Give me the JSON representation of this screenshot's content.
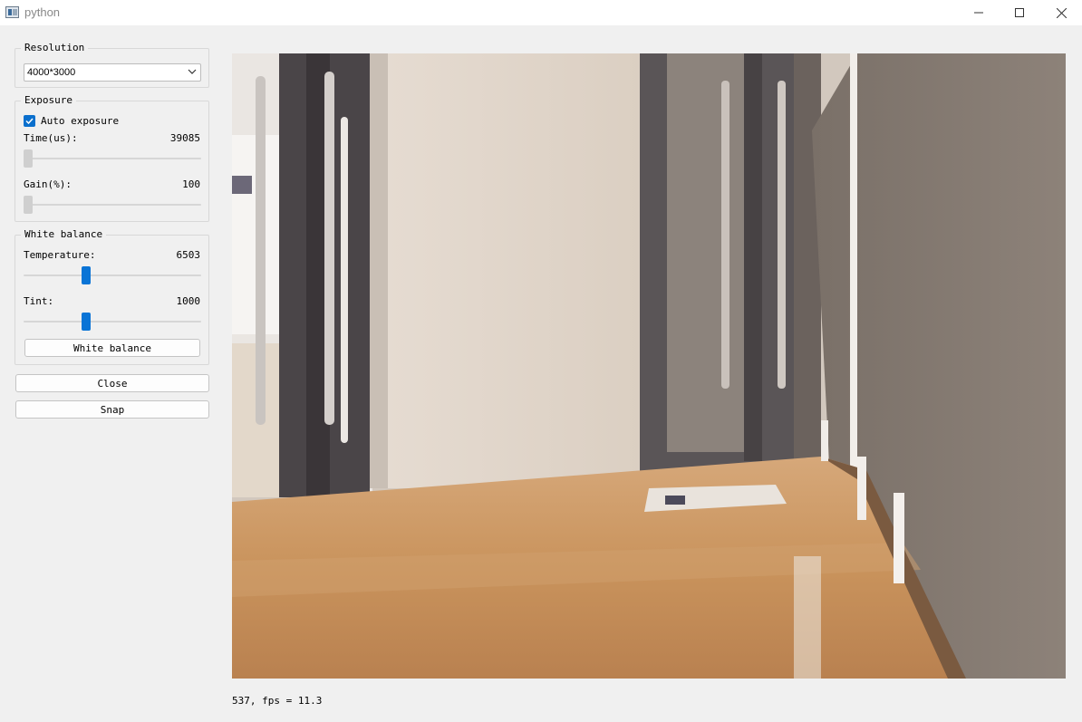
{
  "window": {
    "title": "python"
  },
  "resolution": {
    "title": "Resolution",
    "selected": "4000*3000"
  },
  "exposure": {
    "title": "Exposure",
    "auto_label": "Auto exposure",
    "auto_checked": true,
    "time_label": "Time(us):",
    "time_value": "39085",
    "gain_label": "Gain(%):",
    "gain_value": "100"
  },
  "white_balance": {
    "title": "White balance",
    "temperature_label": "Temperature:",
    "temperature_value": "6503",
    "tint_label": "Tint:",
    "tint_value": "1000",
    "button_label": "White balance"
  },
  "buttons": {
    "close_label": "Close",
    "snap_label": "Snap"
  },
  "status": {
    "text": "537, fps = 11.3"
  },
  "icons": {
    "app": "app-window-icon",
    "minimize": "minimize-icon",
    "maximize": "maximize-icon",
    "close": "close-icon",
    "dropdown": "chevron-down-icon",
    "check": "check-icon"
  },
  "colors": {
    "accent": "#0a74d6",
    "background": "#f0f0f0"
  }
}
